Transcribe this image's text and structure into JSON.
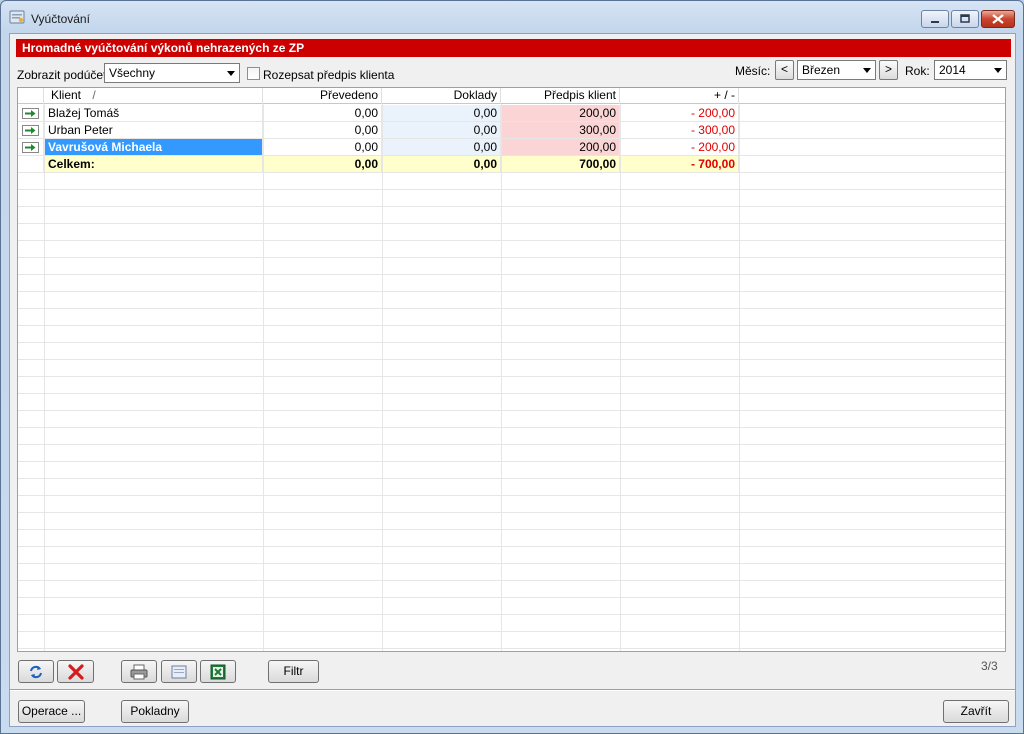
{
  "window": {
    "title": "Vyúčtování",
    "banner": "Hromadné vyúčtování výkonů nehrazených ze ZP"
  },
  "filters": {
    "subaccount_label": "Zobrazit podúčet:",
    "subaccount_value": "Všechny",
    "split_label": "Rozepsat předpis klienta",
    "month_label": "Měsíc:",
    "month_value": "Březen",
    "prev_label": "<",
    "next_label": ">",
    "year_label": "Rok:",
    "year_value": "2014"
  },
  "table": {
    "columns": [
      "Klient",
      "Převedeno",
      "Doklady",
      "Předpis klient",
      "+ / -"
    ],
    "sort_mark": "/",
    "rows": [
      {
        "klient": "Blažej Tomáš",
        "prevedeno": "0,00",
        "doklady": "0,00",
        "predpis": "200,00",
        "diff": "-  200,00"
      },
      {
        "klient": "Urban Peter",
        "prevedeno": "0,00",
        "doklady": "0,00",
        "predpis": "300,00",
        "diff": "-  300,00"
      },
      {
        "klient": "Vavrušová Michaela",
        "prevedeno": "0,00",
        "doklady": "0,00",
        "predpis": "200,00",
        "diff": "-  200,00"
      }
    ],
    "total": {
      "klient": "Celkem:",
      "prevedeno": "0,00",
      "doklady": "0,00",
      "predpis": "700,00",
      "diff": "-  700,00"
    },
    "selected_row": 2
  },
  "toolbar": {
    "filter_label": "Filtr",
    "counter": "3/3"
  },
  "footer": {
    "operations_label": "Operace ...",
    "cash_label": "Pokladny",
    "close_label": "Zavřít"
  },
  "colors": {
    "banner": "#cc0000",
    "negative": "#e00000",
    "selection": "#3399ff",
    "total_row": "#ffffcc",
    "doklady_bg": "#eaf3fb",
    "predpis_bg": "#fbd5d5"
  }
}
